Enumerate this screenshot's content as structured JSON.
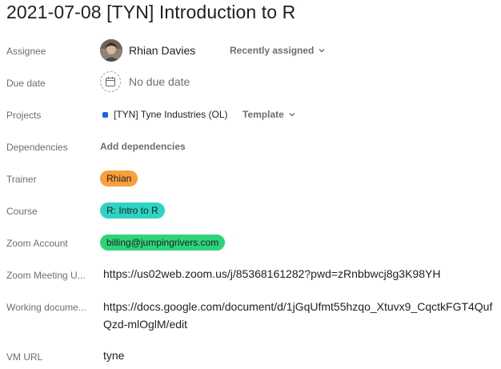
{
  "task": {
    "title": "2021-07-08 [TYN] Introduction to R"
  },
  "fields": {
    "assignee": {
      "label": "Assignee",
      "name": "Rhian Davies",
      "dropdown": "Recently assigned"
    },
    "due_date": {
      "label": "Due date",
      "value": "No due date"
    },
    "projects": {
      "label": "Projects",
      "name": "[TYN] Tyne Industries (OL)",
      "dropdown": "Template",
      "color": "#1f63d8"
    },
    "dependencies": {
      "label": "Dependencies",
      "action": "Add dependencies"
    },
    "trainer": {
      "label": "Trainer",
      "value": "Rhian",
      "color": "#f8a03a"
    },
    "course": {
      "label": "Course",
      "value": "R: Intro to R",
      "color": "#2dd4c4"
    },
    "zoom_account": {
      "label": "Zoom Account",
      "value": "billing@jumpingrivers.com",
      "color": "#2ed47a"
    },
    "zoom_meeting": {
      "label": "Zoom Meeting U...",
      "value": "https://us02web.zoom.us/j/85368161282?pwd=zRnbbwcj8g3K98YH"
    },
    "working_doc": {
      "label": "Working docume...",
      "value_line1": "https://docs.google.com/document/d/1jGqUfmt55hzqo_Xtuvx9_CqctkFGT4Quf",
      "value_line2": "Qzd-mlOglM/edit"
    },
    "vm_url": {
      "label": "VM URL",
      "value": "tyne"
    }
  }
}
